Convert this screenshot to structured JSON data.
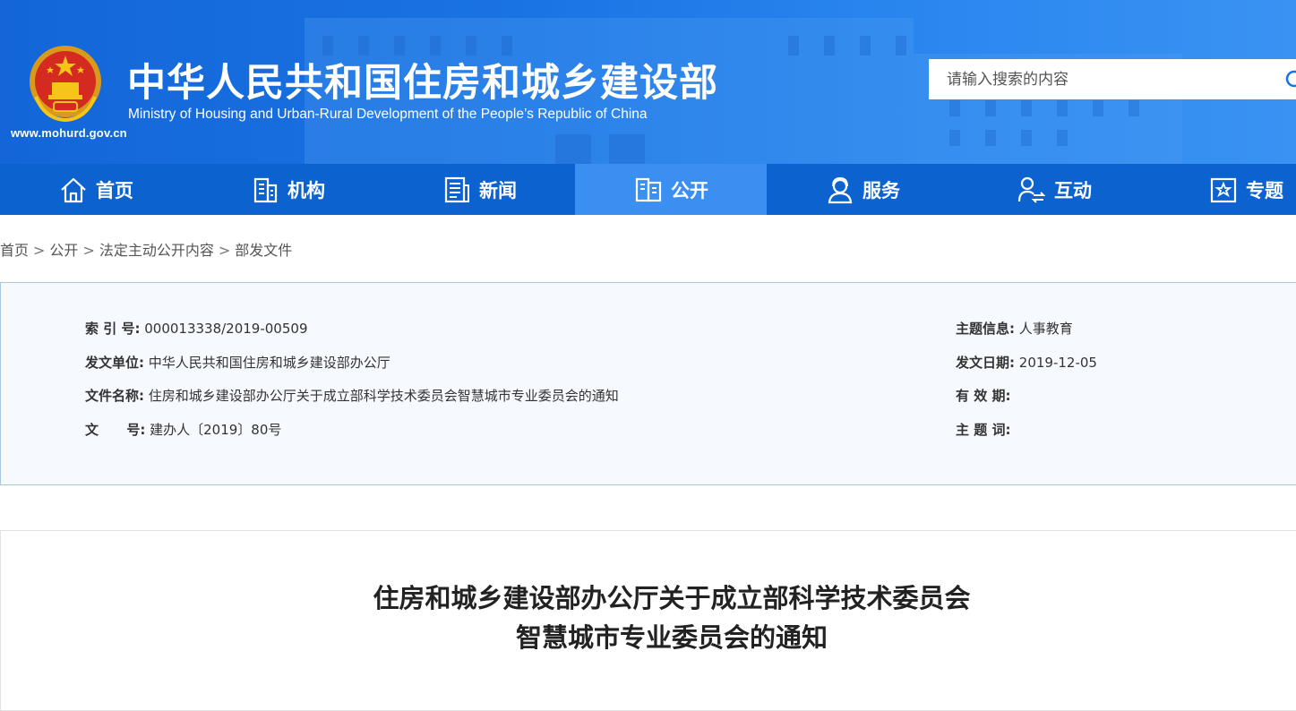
{
  "header": {
    "title_cn": "中华人民共和国住房和城乡建设部",
    "title_en": "Ministry of Housing and Urban-Rural Development of the People’s Republic of China",
    "site_url": "www.mohurd.gov.cn",
    "search_placeholder": "请输入搜索的内容",
    "emblem_icon": "national-emblem-icon"
  },
  "nav": {
    "items": [
      {
        "label": "首页",
        "icon": "home-icon"
      },
      {
        "label": "机构",
        "icon": "building-icon"
      },
      {
        "label": "新闻",
        "icon": "news-icon"
      },
      {
        "label": "公开",
        "icon": "document-icon"
      },
      {
        "label": "服务",
        "icon": "service-icon"
      },
      {
        "label": "互动",
        "icon": "interaction-icon"
      },
      {
        "label": "专题",
        "icon": "star-icon"
      }
    ],
    "active": "公开"
  },
  "breadcrumb": [
    "首页",
    "公开",
    "法定主动公开内容",
    "部发文件"
  ],
  "info": {
    "index_label": "索 引 号:",
    "index_value": "000013338/2019-00509",
    "issuer_label": "发文单位:",
    "issuer_value": "中华人民共和国住房和城乡建设部办公厅",
    "filename_label": "文件名称:",
    "filename_value": "住房和城乡建设部办公厅关于成立部科学技术委员会智慧城市专业委员会的通知",
    "docno_label": "文      号:",
    "docno_value": "建办人〔2019〕80号",
    "topic_label": "主题信息:",
    "topic_value": "人事教育",
    "date_label": "发文日期:",
    "date_value": "2019-12-05",
    "validity_label": "有 效 期:",
    "validity_value": "",
    "keywords_label": "主 题 词:",
    "keywords_value": ""
  },
  "article": {
    "title_line1": "住房和城乡建设部办公厅关于成立部科学技术委员会",
    "title_line2": "智慧城市专业委员会的通知"
  },
  "colors": {
    "banner": "#1a73e3",
    "nav": "#0c63cf",
    "nav_active": "#3b8ff0",
    "info_bg": "#f6f9fe",
    "info_border": "#a9c5e2"
  }
}
